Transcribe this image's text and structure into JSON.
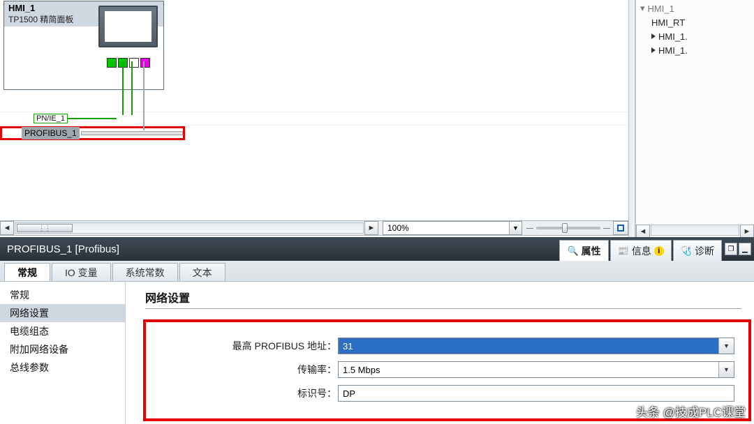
{
  "device": {
    "name": "HMI_1",
    "type": "TP1500 精简面板"
  },
  "networks": {
    "pnie": "PN/IE_1",
    "profibus": "PROFIBUS_1"
  },
  "zoom": "100%",
  "tree": {
    "root": "HMI_1",
    "items": [
      "HMI_RT",
      "HMI_1.",
      "HMI_1."
    ]
  },
  "titlebar": "PROFIBUS_1 [Profibus]",
  "maintabs": {
    "properties": "属性",
    "info": "信息",
    "diag": "诊断"
  },
  "subtabs": {
    "general": "常规",
    "iovars": "IO 变量",
    "sysconst": "系统常数",
    "text": "文本"
  },
  "nav": {
    "general": "常规",
    "netset": "网络设置",
    "cable": "电缆组态",
    "addnet": "附加网络设备",
    "busparam": "总线参数"
  },
  "section": "网络设置",
  "form": {
    "labels": {
      "maxaddr": "最高 PROFIBUS 地址：",
      "baud": "传输率：",
      "ident": "标识号："
    },
    "values": {
      "maxaddr": "31",
      "baud": "1.5 Mbps",
      "ident": "DP"
    }
  },
  "watermark": "头条 @技成PLC课堂"
}
